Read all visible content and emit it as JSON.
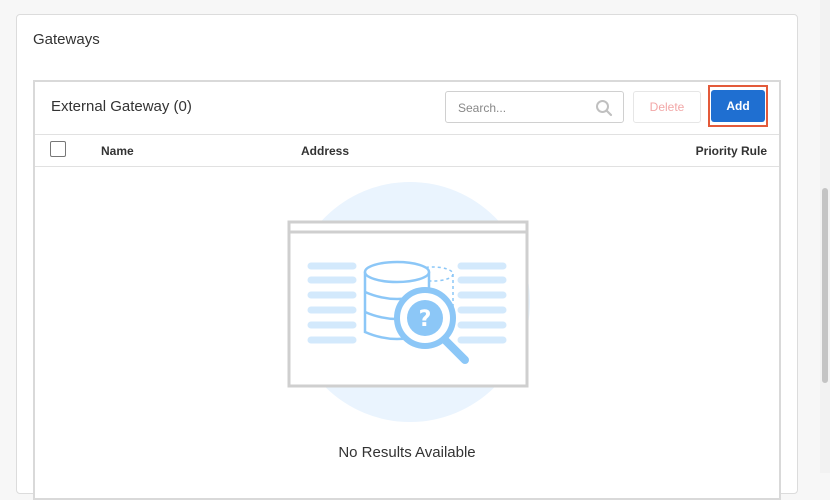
{
  "section": {
    "title": "Gateways"
  },
  "panel": {
    "title": "External Gateway (0)",
    "search": {
      "placeholder": "Search...",
      "value": ""
    },
    "delete_label": "Delete",
    "add_label": "Add"
  },
  "table": {
    "columns": [
      "Name",
      "Address",
      "Priority Rule"
    ]
  },
  "empty_state": {
    "message": "No Results Available"
  },
  "colors": {
    "accent": "#1f6fd1",
    "highlight": "#e35a3a",
    "illustration": "#8cc7f7",
    "illustration_bg": "#eaf4fe"
  },
  "icons": [
    "search-icon",
    "no-results-illustration"
  ]
}
